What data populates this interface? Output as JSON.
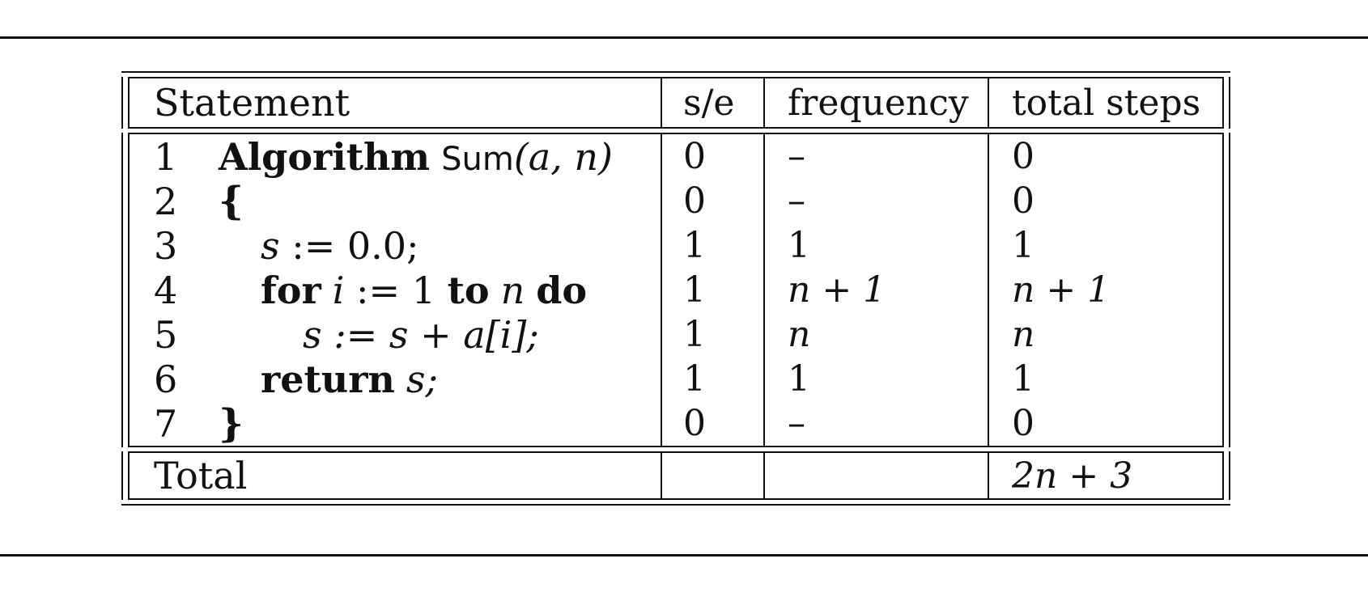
{
  "table": {
    "headers": {
      "statement": "Statement",
      "se": "s/e",
      "frequency": "frequency",
      "total": "total steps"
    },
    "rows": [
      {
        "line": "1",
        "kw1": "Algorithm",
        "name": "Sum",
        "args": "(a, n)",
        "se": "0",
        "freq": "–",
        "total": "0"
      },
      {
        "line": "2",
        "brace": "{",
        "se": "0",
        "freq": "–",
        "total": "0"
      },
      {
        "line": "3",
        "var": "s",
        "assign": " := 0.0;",
        "se": "1",
        "freq": "1",
        "total": "1"
      },
      {
        "line": "4",
        "kw_for": "for",
        "loopvar": "i",
        "from": " := 1 ",
        "kw_to": "to",
        "loopto": "n",
        "kw_do": "do",
        "se": "1",
        "freq": "n + 1",
        "total": "n + 1"
      },
      {
        "line": "5",
        "body": "s := s + a[i];",
        "se": "1",
        "freq": "n",
        "total": "n"
      },
      {
        "line": "6",
        "kw_ret": "return",
        "retvar": "s;",
        "se": "1",
        "freq": "1",
        "total": "1"
      },
      {
        "line": "7",
        "brace": "}",
        "se": "0",
        "freq": "–",
        "total": "0"
      }
    ],
    "footer": {
      "label": "Total",
      "se": "",
      "freq": "",
      "total": "2n + 3"
    }
  }
}
